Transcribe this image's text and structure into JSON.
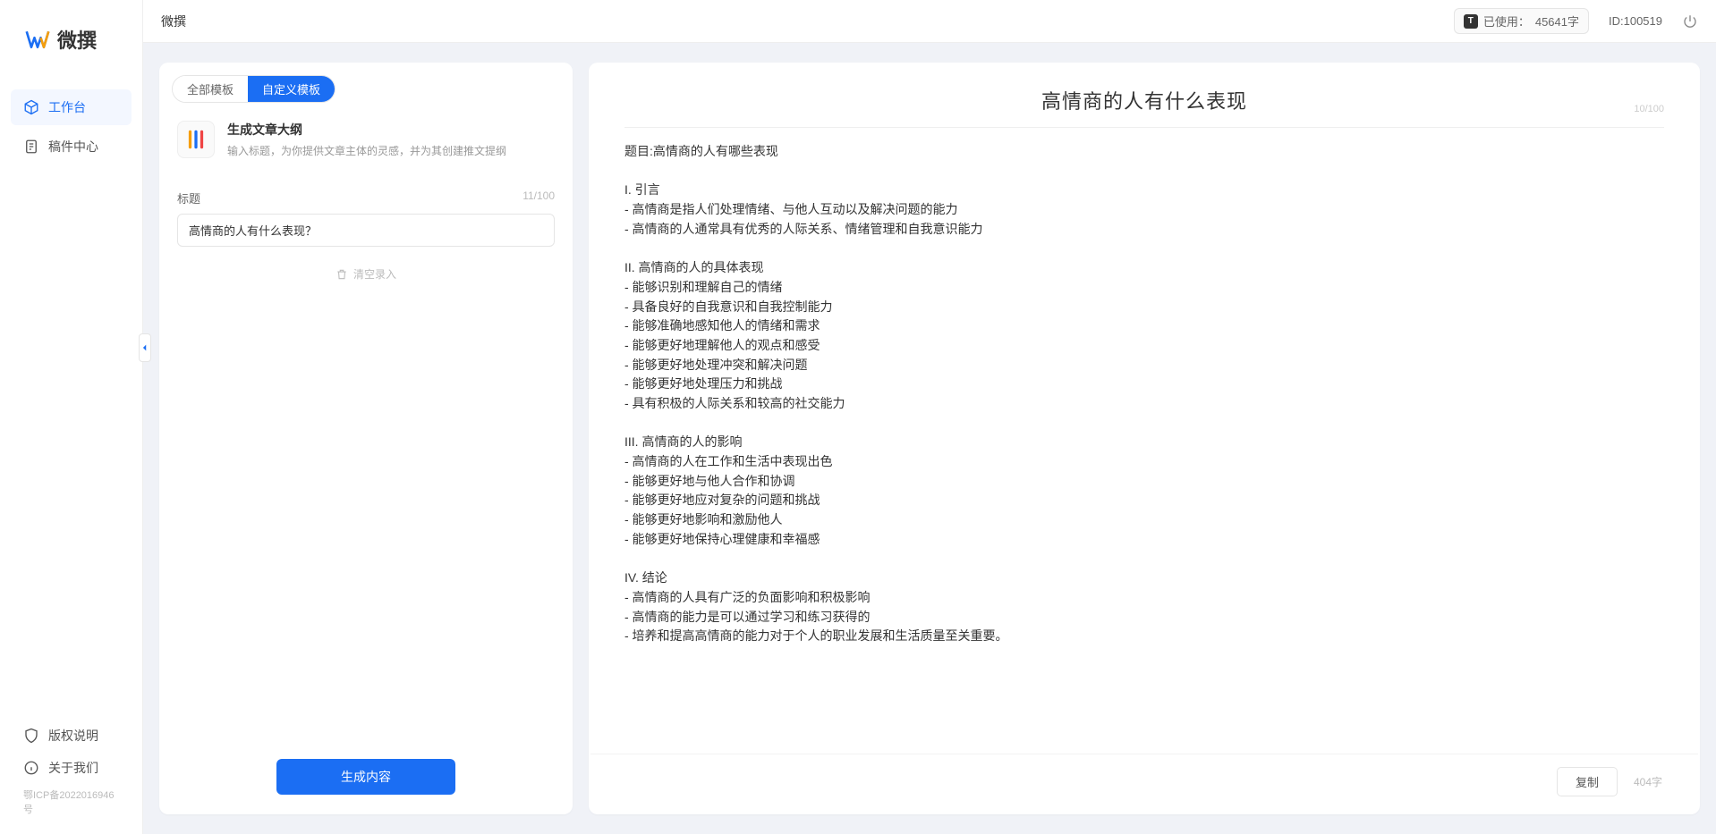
{
  "app": {
    "name": "微撰"
  },
  "sidebar": {
    "nav": [
      {
        "label": "工作台",
        "active": true
      },
      {
        "label": "稿件中心",
        "active": false
      }
    ],
    "footer": [
      {
        "label": "版权说明"
      },
      {
        "label": "关于我们"
      }
    ],
    "icp": "鄂ICP备2022016946号"
  },
  "topbar": {
    "breadcrumb": "微撰",
    "usage_label": "已使用：",
    "usage_value": "45641字",
    "user_id": "ID:100519"
  },
  "left_panel": {
    "tabs": [
      {
        "label": "全部模板",
        "active": false
      },
      {
        "label": "自定义模板",
        "active": true
      }
    ],
    "template": {
      "title": "生成文章大纲",
      "desc": "输入标题，为你提供文章主体的灵感，并为其创建推文提纲"
    },
    "field_label": "标题",
    "field_counter": "11/100",
    "input_value": "高情商的人有什么表现？",
    "clear_label": "清空录入",
    "generate_label": "生成内容"
  },
  "right_panel": {
    "title": "高情商的人有什么表现",
    "title_counter": "10/100",
    "body": "题目:高情商的人有哪些表现\n\nI. 引言\n- 高情商是指人们处理情绪、与他人互动以及解决问题的能力\n- 高情商的人通常具有优秀的人际关系、情绪管理和自我意识能力\n\nII. 高情商的人的具体表现\n- 能够识别和理解自己的情绪\n- 具备良好的自我意识和自我控制能力\n- 能够准确地感知他人的情绪和需求\n- 能够更好地理解他人的观点和感受\n- 能够更好地处理冲突和解决问题\n- 能够更好地处理压力和挑战\n- 具有积极的人际关系和较高的社交能力\n\nIII. 高情商的人的影响\n- 高情商的人在工作和生活中表现出色\n- 能够更好地与他人合作和协调\n- 能够更好地应对复杂的问题和挑战\n- 能够更好地影响和激励他人\n- 能够更好地保持心理健康和幸福感\n\nIV. 结论\n- 高情商的人具有广泛的负面影响和积极影响\n- 高情商的能力是可以通过学习和练习获得的\n- 培养和提高高情商的能力对于个人的职业发展和生活质量至关重要。",
    "copy_label": "复制",
    "word_count": "404字"
  }
}
